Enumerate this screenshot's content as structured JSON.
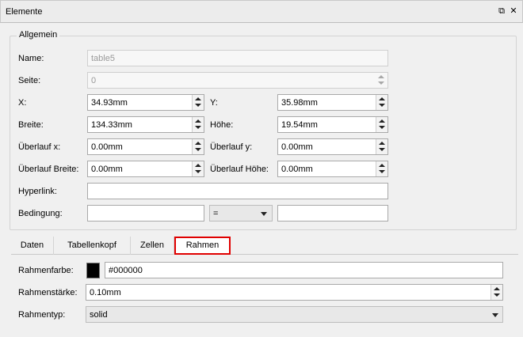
{
  "window": {
    "title": "Elemente"
  },
  "general": {
    "legend": "Allgemein",
    "name_label": "Name:",
    "name_value": "table5",
    "page_label": "Seite:",
    "page_value": "0",
    "x_label": "X:",
    "x_value": "34.93mm",
    "y_label": "Y:",
    "y_value": "35.98mm",
    "width_label": "Breite:",
    "width_value": "134.33mm",
    "height_label": "Höhe:",
    "height_value": "19.54mm",
    "overflow_x_label": "Überlauf x:",
    "overflow_x_value": "0.00mm",
    "overflow_y_label": "Überlauf y:",
    "overflow_y_value": "0.00mm",
    "overflow_width_label": "Überlauf Breite:",
    "overflow_width_value": "0.00mm",
    "overflow_height_label": "Überlauf Höhe:",
    "overflow_height_value": "0.00mm",
    "hyperlink_label": "Hyperlink:",
    "hyperlink_value": "",
    "condition_label": "Bedingung:",
    "condition_left": "",
    "condition_operator": "=",
    "condition_right": ""
  },
  "tabs": [
    {
      "label": "Daten",
      "active": false
    },
    {
      "label": "Tabellenkopf",
      "active": false
    },
    {
      "label": "Zellen",
      "active": false
    },
    {
      "label": "Rahmen",
      "active": true
    }
  ],
  "border": {
    "color_label": "Rahmenfarbe:",
    "color_value": "#000000",
    "swatch_color": "#000000",
    "width_label": "Rahmenstärke:",
    "width_value": "0.10mm",
    "type_label": "Rahmentyp:",
    "type_value": "solid"
  },
  "colors": {
    "highlight": "#e00000"
  }
}
